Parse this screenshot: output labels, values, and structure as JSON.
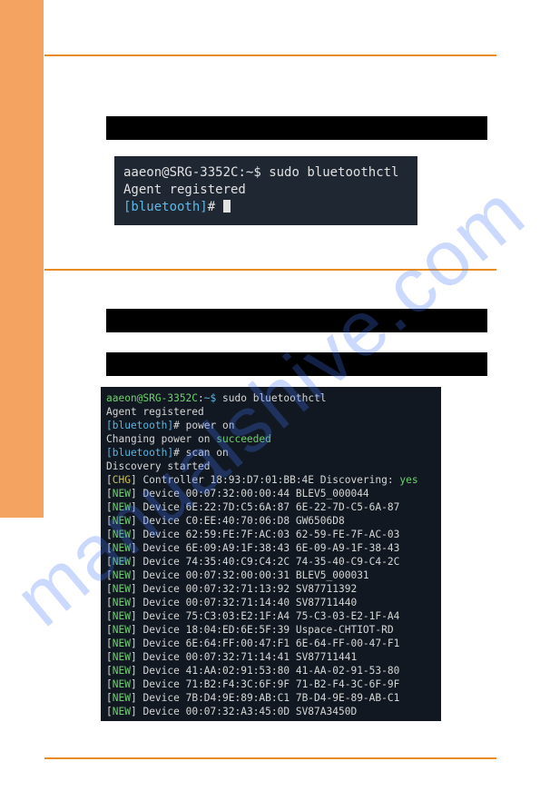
{
  "watermark": "manualshive.com",
  "terminal1": {
    "prompt_user": "aaeon@SRG-3352C",
    "prompt_sep": ":",
    "prompt_path": "~",
    "prompt_end": "$",
    "cmd": "sudo bluetoothctl",
    "line2": "Agent registered",
    "bt_prompt": "[bluetooth]",
    "bt_hash": "#"
  },
  "terminal2": {
    "prompt_user": "aaeon@SRG-3352C",
    "prompt_path": "~$",
    "cmd1": "sudo bluetoothctl",
    "line_agent": "Agent registered",
    "bt_prompt": "[bluetooth]",
    "bt_hash": "#",
    "cmd_power": "power on",
    "changing_prefix": "Changing power on ",
    "changing_succeeded": "succeeded",
    "cmd_scan": "scan on",
    "discovery": "Discovery started",
    "chg_label": "CHG",
    "chg_text": "] Controller 18:93:D7:01:BB:4E Discovering: ",
    "chg_yes": "yes",
    "new_label": "NEW",
    "devices": [
      "Device 00:07:32:00:00:44 BLEV5_000044",
      "Device 6E:22:7D:C5:6A:87 6E-22-7D-C5-6A-87",
      "Device C0:EE:40:70:06:D8 GW6506D8",
      "Device 62:59:FE:7F:AC:03 62-59-FE-7F-AC-03",
      "Device 6E:09:A9:1F:38:43 6E-09-A9-1F-38-43",
      "Device 74:35:40:C9:C4:2C 74-35-40-C9-C4-2C",
      "Device 00:07:32:00:00:31 BLEV5_000031",
      "Device 00:07:32:71:13:92 SV87711392",
      "Device 00:07:32:71:14:40 SV87711440",
      "Device 75:C3:03:E2:1F:A4 75-C3-03-E2-1F-A4",
      "Device 18:04:ED:6E:5F:39 Uspace-CHTIOT-RD",
      "Device 6E:64:FF:00:47:F1 6E-64-FF-00-47-F1",
      "Device 00:07:32:71:14:41 SV87711441",
      "Device 41:AA:02:91:53:80 41-AA-02-91-53-80",
      "Device 71:B2:F4:3C:6F:9F 71-B2-F4-3C-6F-9F",
      "Device 7B:D4:9E:89:AB:C1 7B-D4-9E-89-AB-C1",
      "Device 00:07:32:A3:45:0D SV87A3450D"
    ]
  }
}
